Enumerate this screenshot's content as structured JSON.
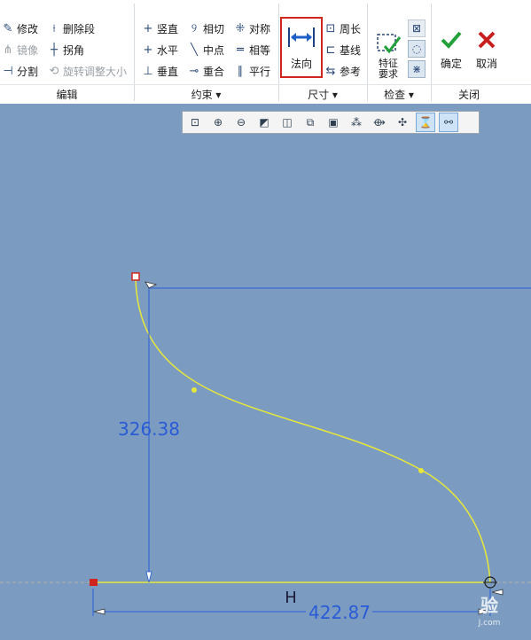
{
  "ribbon": {
    "edit_group": {
      "label": "编辑",
      "modify": "修改",
      "delete_segment": "删除段",
      "mirror": "镜像",
      "corner": "拐角",
      "divide": "分割",
      "rotate_resize": "旋转调整大小"
    },
    "constrain_group": {
      "label": "约束 ▾",
      "vertical": "竖直",
      "tangent": "相切",
      "symmetric": "对称",
      "horizontal": "水平",
      "midpoint": "中点",
      "equal": "相等",
      "perpendicular": "垂直",
      "coincident": "重合",
      "parallel": "平行"
    },
    "dimension_group": {
      "label": "尺寸 ▾",
      "normal": "法向",
      "perimeter": "周长",
      "baseline": "基线",
      "reference": "参考"
    },
    "inspect_group": {
      "label": "检查 ▾",
      "feature_req_line1": "特征",
      "feature_req_line2": "要求"
    },
    "close_group": {
      "label": "关闭",
      "ok": "确定",
      "cancel": "取消"
    }
  },
  "sketch": {
    "dim_vertical": "326.38",
    "dim_horizontal": "422.87",
    "constraint_label": "H",
    "watermark_main": "验",
    "watermark_sub": "J.com"
  },
  "colors": {
    "canvas": "#7b9cc0",
    "curve": "#e8e83a",
    "dimension": "#2a5bd7",
    "highlight_box": "#d0261f",
    "ok_green": "#22a03a",
    "cancel_red": "#c81e1e"
  }
}
